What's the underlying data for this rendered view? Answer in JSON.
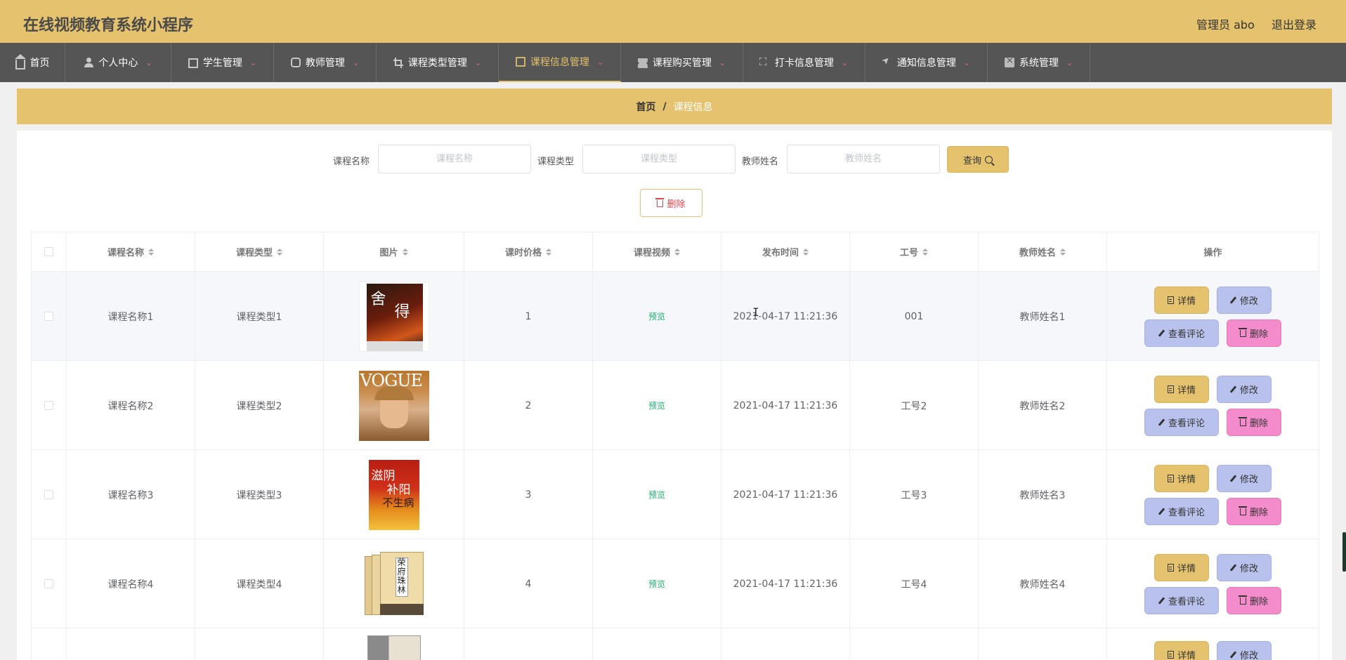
{
  "header": {
    "title": "在线视频教育系统小程序",
    "user": "管理员 abo",
    "logout": "退出登录"
  },
  "nav": [
    {
      "label": "首页",
      "icon": "home-icon"
    },
    {
      "label": "个人中心",
      "icon": "user-icon"
    },
    {
      "label": "学生管理",
      "icon": "id-card-icon"
    },
    {
      "label": "教师管理",
      "icon": "mic-icon"
    },
    {
      "label": "课程类型管理",
      "icon": "crop-icon"
    },
    {
      "label": "课程信息管理",
      "icon": "clipboard-icon",
      "active": true
    },
    {
      "label": "课程购买管理",
      "icon": "ticket-icon"
    },
    {
      "label": "打卡信息管理",
      "icon": "fullscreen-icon"
    },
    {
      "label": "通知信息管理",
      "icon": "navigation-icon"
    },
    {
      "label": "系统管理",
      "icon": "system-icon"
    }
  ],
  "breadcrumb": {
    "home": "首页",
    "separator": "/",
    "current": "课程信息"
  },
  "search": {
    "course_name_label": "课程名称",
    "course_name_placeholder": "课程名称",
    "course_type_label": "课程类型",
    "course_type_placeholder": "课程类型",
    "teacher_label": "教师姓名",
    "teacher_placeholder": "教师姓名",
    "query_label": "查询"
  },
  "toolbar": {
    "delete_label": "删除"
  },
  "table": {
    "headers": [
      "课程名称",
      "课程类型",
      "图片",
      "课时价格",
      "课程视频",
      "发布时间",
      "工号",
      "教师姓名",
      "操作"
    ],
    "rows": [
      {
        "name": "课程名称1",
        "type": "课程类型1",
        "price": "1",
        "video": "预览",
        "time": "2021-04-17 11:21:36",
        "id": "001",
        "teacher": "教师姓名1"
      },
      {
        "name": "课程名称2",
        "type": "课程类型2",
        "price": "2",
        "video": "预览",
        "time": "2021-04-17 11:21:36",
        "id": "工号2",
        "teacher": "教师姓名2"
      },
      {
        "name": "课程名称3",
        "type": "课程类型3",
        "price": "3",
        "video": "预览",
        "time": "2021-04-17 11:21:36",
        "id": "工号3",
        "teacher": "教师姓名3"
      },
      {
        "name": "课程名称4",
        "type": "课程类型4",
        "price": "4",
        "video": "预览",
        "time": "2021-04-17 11:21:36",
        "id": "工号4",
        "teacher": "教师姓名4"
      }
    ],
    "actions": {
      "detail": "详情",
      "edit": "修改",
      "comment": "查看评论",
      "delete": "删除"
    }
  },
  "colors": {
    "accent": "#e5c26d",
    "nav_bg": "#555555",
    "preview": "#1bb36b",
    "edit_btn": "#b9c2ec",
    "delete_btn": "#f48bcb"
  }
}
